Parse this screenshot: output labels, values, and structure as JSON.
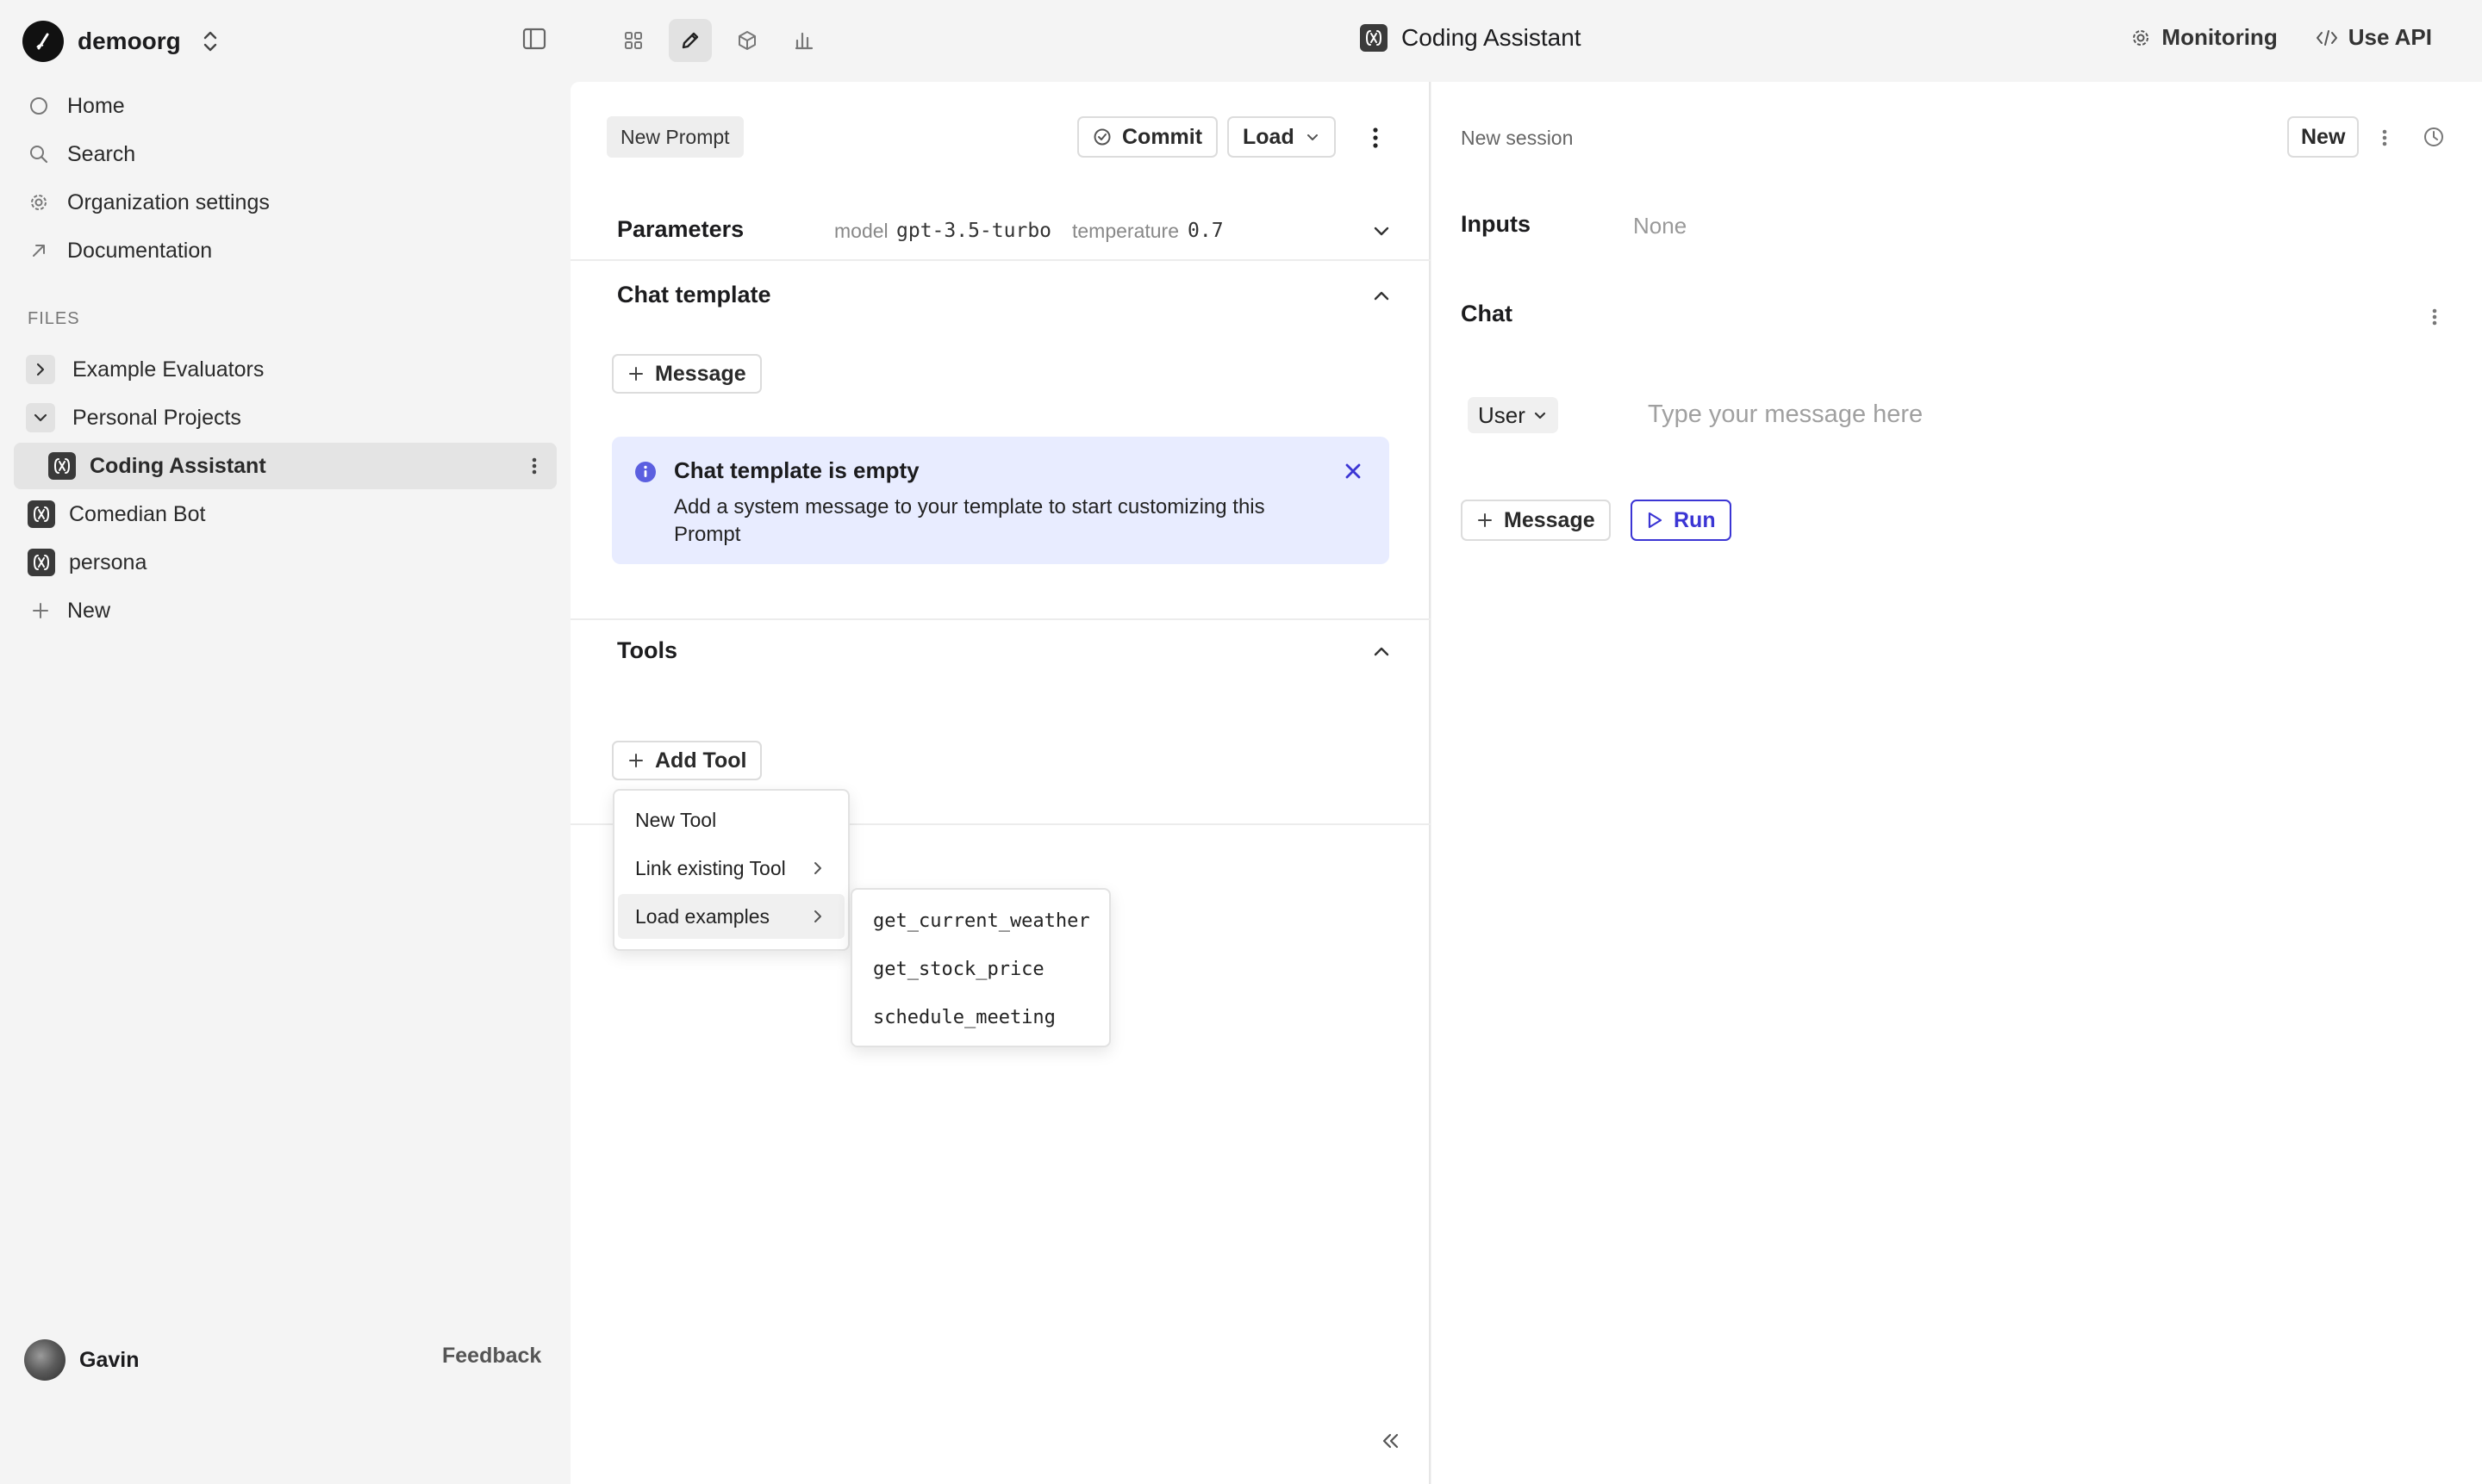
{
  "org": {
    "name": "demoorg"
  },
  "header": {
    "file_title": "Coding Assistant",
    "actions": {
      "monitoring": "Monitoring",
      "use_api": "Use API"
    }
  },
  "sidebar": {
    "nav": {
      "home": "Home",
      "search": "Search",
      "org_settings": "Organization settings",
      "documentation": "Documentation"
    },
    "files_label": "FILES",
    "files": {
      "example_evaluators": "Example Evaluators",
      "personal_projects": "Personal Projects",
      "coding_assistant": "Coding Assistant",
      "comedian_bot": "Comedian Bot",
      "persona": "persona",
      "new": "New"
    },
    "user": {
      "name": "Gavin"
    },
    "feedback": "Feedback"
  },
  "editor": {
    "badge": "New Prompt",
    "commit_label": "Commit",
    "load_label": "Load",
    "parameters": {
      "title": "Parameters",
      "model_label": "model",
      "model_value": "gpt-3.5-turbo",
      "temperature_label": "temperature",
      "temperature_value": "0.7"
    },
    "chat_template": {
      "title": "Chat template",
      "add_message_label": "Message",
      "info_title": "Chat template is empty",
      "info_body": "Add a system message to your template to start customizing this Prompt"
    },
    "tools": {
      "title": "Tools",
      "add_tool_label": "Add Tool",
      "menu": {
        "new_tool": "New Tool",
        "link_existing": "Link existing Tool",
        "load_examples": "Load examples"
      },
      "examples": [
        "get_current_weather",
        "get_stock_price",
        "schedule_meeting"
      ]
    }
  },
  "chat_panel": {
    "session_label": "New session",
    "new_button": "New",
    "inputs_title": "Inputs",
    "inputs_value": "None",
    "chat_title": "Chat",
    "role_select": "User",
    "message_placeholder": "Type your message here",
    "add_message_label": "Message",
    "run_label": "Run"
  },
  "colors": {
    "accent": "#3b35d4",
    "info_bg": "#e8ecff",
    "info_icon": "#5b5fe0"
  }
}
